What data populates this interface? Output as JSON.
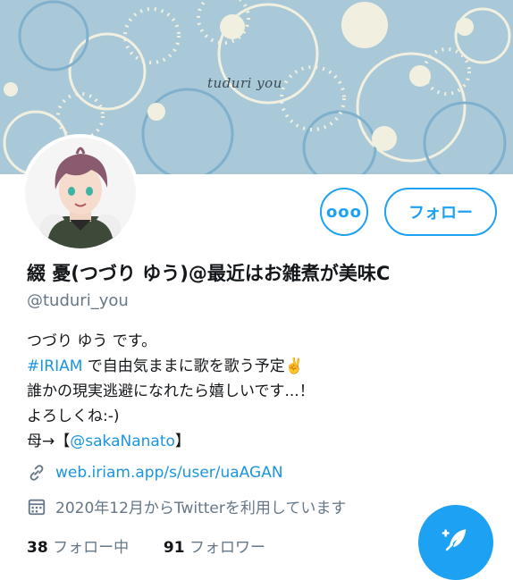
{
  "banner": {
    "text": "tuduri you",
    "bg_color": "#a9c8d8"
  },
  "actions": {
    "more_label": "ooo",
    "follow_label": "フォロー"
  },
  "profile": {
    "display_name": "綴 憂(つづり ゆう)@最近はお雑煮が美味C",
    "handle": "@tuduri_you"
  },
  "bio": {
    "line1": "つづり ゆう です。",
    "line2_hashtag": "#IRIAM",
    "line2_rest": " で自由気ままに歌を歌う予定✌️",
    "line3": "誰かの現実逃避になれたら嬉しいです...！",
    "line4": "よろしくね:-)",
    "line5_prefix": "母→【",
    "line5_mention": "@sakaNanato",
    "line5_suffix": "】"
  },
  "meta": {
    "link_icon": "link-icon",
    "website": "web.iriam.app/s/user/uaAGAN",
    "calendar_icon": "calendar-icon",
    "joined": "2020年12月からTwitterを利用しています"
  },
  "stats": {
    "following_count": "38",
    "following_label": "フォロー中",
    "followers_count": "91",
    "followers_label": "フォロワー"
  },
  "fab": {
    "icon": "compose-tweet-icon"
  },
  "colors": {
    "accent": "#1da1f2",
    "muted": "#657786",
    "text": "#14171a"
  }
}
